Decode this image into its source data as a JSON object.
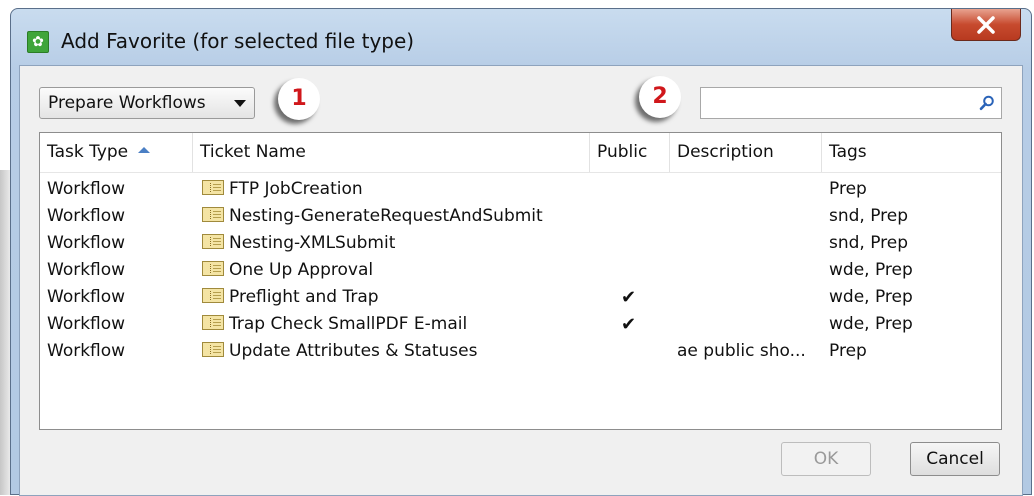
{
  "window": {
    "title": "Add Favorite (for selected file type)"
  },
  "toolbar": {
    "dropdown_value": "Prepare Workflows",
    "callout_1": "1",
    "callout_2": "2",
    "search_value": "",
    "search_placeholder": ""
  },
  "table": {
    "columns": [
      {
        "label": "Task Type",
        "sorted": "ascending"
      },
      {
        "label": "Ticket Name"
      },
      {
        "label": "Public"
      },
      {
        "label": "Description"
      },
      {
        "label": "Tags"
      }
    ],
    "rows": [
      {
        "task_type": "Workflow",
        "ticket_name": "FTP JobCreation",
        "public": "",
        "description": "",
        "tags": "Prep"
      },
      {
        "task_type": "Workflow",
        "ticket_name": "Nesting-GenerateRequestAndSubmit",
        "public": "",
        "description": "",
        "tags": "snd, Prep"
      },
      {
        "task_type": "Workflow",
        "ticket_name": "Nesting-XMLSubmit",
        "public": "",
        "description": "",
        "tags": "snd, Prep"
      },
      {
        "task_type": "Workflow",
        "ticket_name": "One Up Approval",
        "public": "",
        "description": "",
        "tags": "wde, Prep"
      },
      {
        "task_type": "Workflow",
        "ticket_name": "Preflight and Trap",
        "public": "✔",
        "description": "",
        "tags": "wde, Prep"
      },
      {
        "task_type": "Workflow",
        "ticket_name": "Trap Check SmallPDF E-mail",
        "public": "✔",
        "description": "",
        "tags": "wde, Prep"
      },
      {
        "task_type": "Workflow",
        "ticket_name": "Update Attributes & Statuses",
        "public": "",
        "description": "ae public sho...",
        "tags": "Prep"
      }
    ]
  },
  "buttons": {
    "ok": "OK",
    "cancel": "Cancel"
  },
  "icons": {
    "app": "gear-icon",
    "close": "close-icon",
    "search": "search-icon",
    "ticket": "ticket-icon",
    "sort": "sort-ascending-icon"
  },
  "colors": {
    "callout_text": "#d0171b",
    "close_button": "#c74a2e",
    "app_icon": "#3fa53a"
  }
}
